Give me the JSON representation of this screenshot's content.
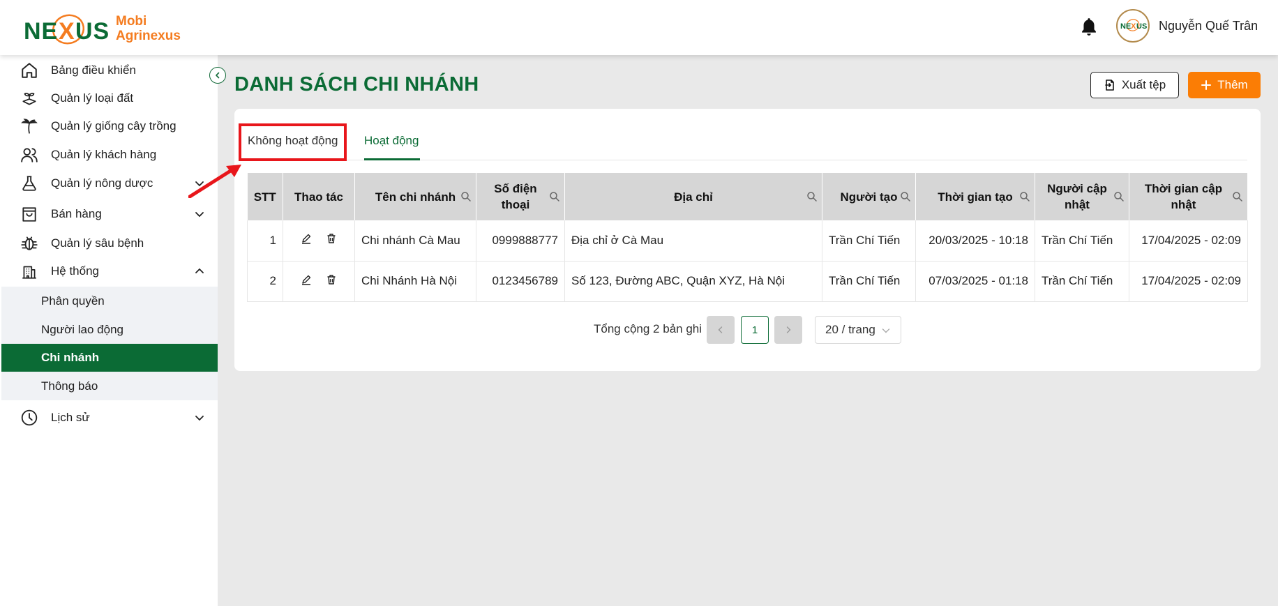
{
  "header": {
    "brand_line1": "Mobi",
    "brand_line2": "Agrinexus",
    "logo_text": "NEXUS",
    "user_name": "Nguyễn Quế Trân"
  },
  "sidebar": {
    "items": [
      {
        "label": "Bảng điều khiển",
        "icon": "home-icon"
      },
      {
        "label": "Quản lý loại đất",
        "icon": "soil-plant-icon"
      },
      {
        "label": "Quản lý giống cây trồng",
        "icon": "palm-tree-icon"
      },
      {
        "label": "Quản lý khách hàng",
        "icon": "users-icon"
      },
      {
        "label": "Quản lý nông dược",
        "icon": "flask-icon",
        "expandable": true
      },
      {
        "label": "Bán hàng",
        "icon": "shopping-bag-icon",
        "expandable": true
      },
      {
        "label": "Quản lý sâu bệnh",
        "icon": "bug-icon"
      },
      {
        "label": "Hệ thống",
        "icon": "building-icon",
        "expandable": true,
        "expanded": true
      },
      {
        "label": "Lịch sử",
        "icon": "clock-icon",
        "expandable": true
      }
    ],
    "system_sub_items": [
      {
        "label": "Phân quyền"
      },
      {
        "label": "Người lao động"
      },
      {
        "label": "Chi nhánh",
        "active": true
      },
      {
        "label": "Thông báo"
      }
    ]
  },
  "page": {
    "title": "DANH SÁCH CHI NHÁNH",
    "export_label": "Xuất tệp",
    "add_label": "Thêm"
  },
  "tabs": [
    {
      "label": "Không hoạt động",
      "active": false
    },
    {
      "label": "Hoạt động",
      "active": true
    }
  ],
  "table": {
    "columns": [
      "STT",
      "Thao tác",
      "Tên chi nhánh",
      "Số điện thoại",
      "Địa chỉ",
      "Người tạo",
      "Thời gian tạo",
      "Người cập nhật",
      "Thời gian cập nhật"
    ],
    "rows": [
      {
        "stt": "1",
        "name": "Chi nhánh Cà Mau",
        "phone": "0999888777",
        "address": "Địa chỉ ở Cà Mau",
        "creator": "Trần Chí Tiến",
        "created_at": "20/03/2025 - 10:18",
        "updater": "Trần Chí Tiến",
        "updated_at": "17/04/2025 - 02:09"
      },
      {
        "stt": "2",
        "name": "Chi Nhánh Hà Nội",
        "phone": "0123456789",
        "address": "Số 123, Đường ABC, Quận XYZ, Hà Nội",
        "creator": "Trần Chí Tiến",
        "created_at": "07/03/2025 - 01:18",
        "updater": "Trần Chí Tiến",
        "updated_at": "17/04/2025 - 02:09"
      }
    ]
  },
  "pagination": {
    "total_text": "Tổng cộng 2 bản ghi",
    "current_page": "1",
    "page_size": "20 / trang"
  },
  "colors": {
    "primary_green": "#0b6b35",
    "accent_orange": "#fb7d05",
    "highlight_red": "#e8161b"
  }
}
